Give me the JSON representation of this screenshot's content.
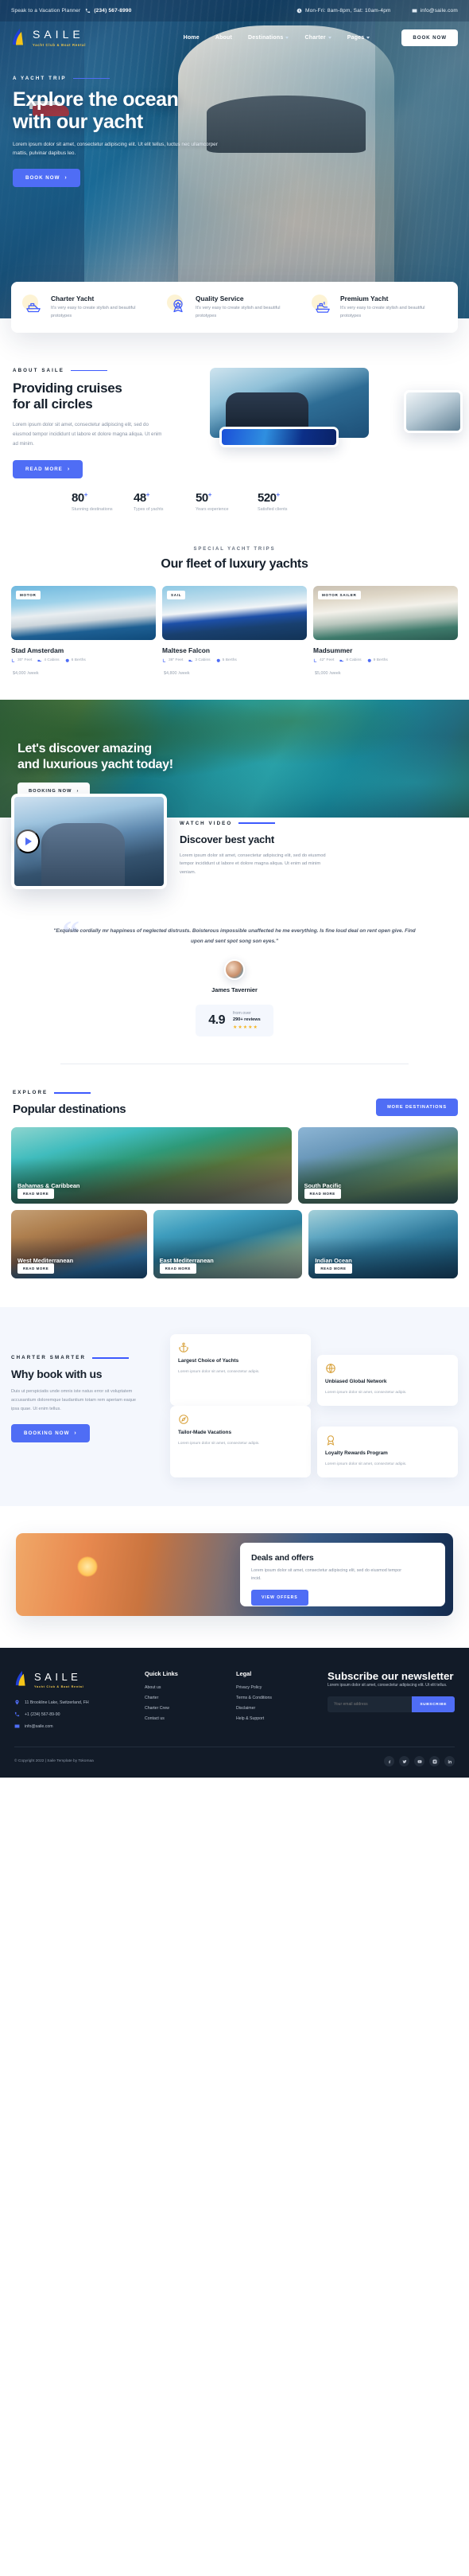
{
  "topbar": {
    "speak_label": "Speak to a Vacation Planner",
    "phone": "(234) 567-8990",
    "hours": "Mon-Fri: 8am-8pm, Sat: 10am-4pm",
    "email": "info@saile.com"
  },
  "brand": {
    "name": "SAILE",
    "tagline": "Yacht Club & Boat Rental"
  },
  "nav": {
    "items": [
      {
        "label": "Home",
        "caret": false
      },
      {
        "label": "About",
        "caret": false
      },
      {
        "label": "Destinations",
        "caret": true
      },
      {
        "label": "Charter",
        "caret": true
      },
      {
        "label": "Pages",
        "caret": true
      }
    ],
    "cta": "BOOK NOW"
  },
  "hero": {
    "eyebrow": "A YACHT TRIP",
    "title_line1": "Explore the ocean",
    "title_line2": "with our yacht",
    "subtitle": "Lorem ipsum dolor sit amet, consectetur adipiscing elit. Ut elit tellus, luctus nec ullamcorper mattis, pulvinar dapibus leo.",
    "cta": "BOOK NOW"
  },
  "features": [
    {
      "icon": "speedboat-icon",
      "title": "Charter Yacht",
      "text": "It's very easy to create stylish and beautiful prototypes"
    },
    {
      "icon": "quality-badge-icon",
      "title": "Quality Service",
      "text": "It's very easy to create stylish and beautiful prototypes"
    },
    {
      "icon": "yacht-icon",
      "title": "Premium Yacht",
      "text": "It's very easy to create stylish and beautiful prototypes"
    }
  ],
  "about": {
    "eyebrow": "ABOUT SAILE",
    "title_line1": "Providing cruises",
    "title_line2": "for all circles",
    "text": "Lorem ipsum dolor sit amet, consectetur adipiscing elit, sed do eiusmod tempor incididunt ut labore et dolore magna aliqua. Ut enim ad minim.",
    "cta": "READ MORE",
    "stats": [
      {
        "value": "80",
        "plus": "+",
        "label": "Stunning destinations"
      },
      {
        "value": "48",
        "plus": "+",
        "label": "Types of yachts"
      },
      {
        "value": "50",
        "plus": "+",
        "label": "Years experience"
      },
      {
        "value": "520",
        "plus": "+",
        "label": "Satisfied clients"
      }
    ]
  },
  "fleet": {
    "eyebrow": "SPECIAL YACHT TRIPS",
    "title": "Our fleet of luxury yachts",
    "yachts": [
      {
        "tag": "MOTOR",
        "name": "Stad Amsterdam",
        "feet": "30\" Feet",
        "cabins": "4 Cabins",
        "berths": "6 Berths",
        "price": "$4,000",
        "period": "/week"
      },
      {
        "tag": "SAIL",
        "name": "Maltese Falcon",
        "feet": "38\" Feet",
        "cabins": "3 Cabins",
        "berths": "5 Berths",
        "price": "$4,800",
        "period": "/week"
      },
      {
        "tag": "MOTOR SAILER",
        "name": "Madsummer",
        "feet": "42\" Feet",
        "cabins": "8 Cabins",
        "berths": "9 Berths",
        "price": "$5,000",
        "period": "/week"
      }
    ]
  },
  "banner": {
    "title_line1": "Let's discover amazing",
    "title_line2": "and luxurious yacht today!",
    "cta": "BOOKING NOW"
  },
  "video": {
    "eyebrow": "WATCH VIDEO",
    "title": "Discover best yacht",
    "text": "Lorem ipsum dolor sit amet, consectetur adipiscing elit, sed do eiusmod tempor incididunt ut labore et dolore magna aliqua. Ut enim ad minim veniam."
  },
  "testimonial": {
    "quote": "\"Exquisite cordially mr happiness of neglected distrusts. Boisterous impossible unaffected he me everything. Is fine loud deal on rent open give. Find upon and sent spot song son eyes.\"",
    "author": "James Tavernier",
    "rating": "4.9",
    "from_label": "from over",
    "count_label": "290+ reviews",
    "stars": "★★★★★"
  },
  "destinations": {
    "eyebrow": "EXPLORE",
    "title": "Popular destinations",
    "cta": "MORE DESTINATIONS",
    "read_more": "READ MORE",
    "items": [
      {
        "name": "Bahamas & Caribbean"
      },
      {
        "name": "South Pacific"
      },
      {
        "name": "West Mediterranean"
      },
      {
        "name": "East Mediterranean"
      },
      {
        "name": "Indian Ocean"
      }
    ]
  },
  "why": {
    "eyebrow": "CHARTER SMARTER",
    "title": "Why book with us",
    "text": "Duis ut perspiciatis unde omnis iste natus error sit voluptatem accusantium doloremque laudantium totam rem aperiam eaque ipsa quae. Ut enim tellus.",
    "cta": "BOOKING NOW",
    "cards": [
      {
        "icon": "anchor-icon",
        "title": "Largest Choice of Yachts",
        "text": "Lorem ipsum dolor sit amet, consectetur adipis."
      },
      {
        "icon": "globe-icon",
        "title": "Unbiased Global Network",
        "text": "Lorem ipsum dolor sit amet, consectetur adipis."
      },
      {
        "icon": "compass-icon",
        "title": "Tailor-Made Vacations",
        "text": "Lorem ipsum dolor sit amet, consectetur adipis."
      },
      {
        "icon": "award-icon",
        "title": "Loyalty Rewards Program",
        "text": "Lorem ipsum dolor sit amet, consectetur adipis."
      }
    ]
  },
  "deals": {
    "title": "Deals and offers",
    "text": "Lorem ipsum dolor sit amet, consectetur adipiscing elit, sed do eiusmod tempor incid.",
    "cta": "VIEW OFFERS"
  },
  "footer": {
    "contacts": [
      {
        "icon": "location-icon",
        "text": "11 Brookline Lake, Switzerland, FH"
      },
      {
        "icon": "phone-icon",
        "text": "+1 (234) 567-89-90"
      },
      {
        "icon": "mail-icon",
        "text": "info@saile.com"
      }
    ],
    "quick_links": {
      "heading": "Quick Links",
      "items": [
        "About us",
        "Charter",
        "Charter Crew",
        "Contact us"
      ]
    },
    "legal": {
      "heading": "Legal",
      "items": [
        "Privacy Policy",
        "Terms & Conditions",
        "Disclaimer",
        "Help & Support"
      ]
    },
    "newsletter": {
      "heading": "Subscribe our newsletter",
      "text": "Lorem ipsum dolor sit amet, consectetur adipiscing elit. Ut elit tellus.",
      "placeholder": "Your email address",
      "button": "SUBSCRIBE"
    },
    "copyright": "© Copyright 2022 | Saile Template by Tokomaa",
    "socials": [
      "facebook-icon",
      "twitter-icon",
      "youtube-icon",
      "instagram-icon",
      "linkedin-icon"
    ]
  }
}
